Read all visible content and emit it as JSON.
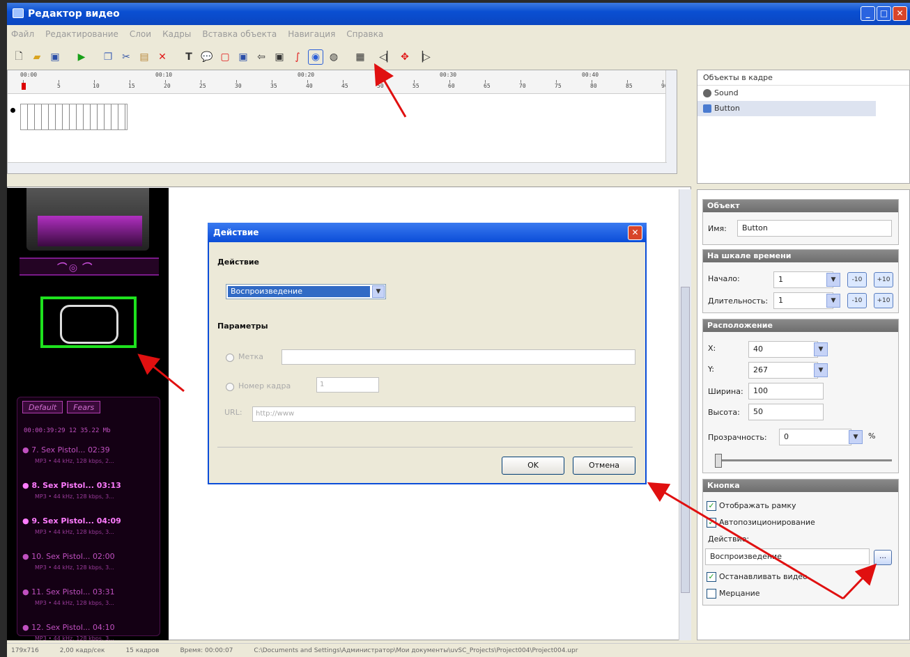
{
  "window": {
    "title": "Редактор видео"
  },
  "menu": [
    "Файл",
    "Редактирование",
    "Слои",
    "Кадры",
    "Вставка объекта",
    "Навигация",
    "Справка"
  ],
  "toolbar_icons": [
    "new-icon",
    "open-icon",
    "save-icon",
    "play-icon",
    "copy-icon",
    "cut-icon",
    "paste-icon",
    "delete-icon",
    "text-icon",
    "callout-icon",
    "rectangle-icon",
    "image-icon",
    "back-icon",
    "frame-icon",
    "pen-icon",
    "button-object-icon",
    "sound-icon",
    "properties-icon",
    "prev-icon",
    "move-icon",
    "next-icon"
  ],
  "timeline": {
    "time_labels": [
      "00:00",
      "00:10",
      "00:20",
      "00:30",
      "00:40"
    ],
    "frame_numbers": [
      "1",
      "5",
      "10",
      "15",
      "20",
      "25",
      "30",
      "35",
      "40",
      "45",
      "50",
      "55",
      "60",
      "65",
      "70",
      "75",
      "80",
      "85",
      "90"
    ]
  },
  "objects_panel": {
    "header": "Объекты в кадре",
    "items": [
      "Sound",
      "Button"
    ]
  },
  "player": {
    "tabs": [
      "Default",
      "Fears"
    ],
    "stat": "00:00:39:29  12     35.22 Mb",
    "tracks": [
      {
        "title": "7. Sex Pistol...",
        "time": "02:39",
        "sub": "MP3 • 44 kHz, 128 kbps, 2..."
      },
      {
        "title": "8. Sex Pistol...",
        "time": "03:13",
        "sub": "MP3 • 44 kHz, 128 kbps, 3..."
      },
      {
        "title": "9. Sex Pistol...",
        "time": "04:09",
        "sub": "MP3 • 44 kHz, 128 kbps, 3..."
      },
      {
        "title": "10. Sex Pistol...",
        "time": "02:00",
        "sub": "MP3 • 44 kHz, 128 kbps, 3..."
      },
      {
        "title": "11. Sex Pistol...",
        "time": "03:31",
        "sub": "MP3 • 44 kHz, 128 kbps, 3..."
      },
      {
        "title": "12. Sex Pistol...",
        "time": "04:10",
        "sub": "MP3 • 44 kHz, 128 kbps, 3..."
      }
    ]
  },
  "dialog": {
    "title": "Действие",
    "action_label": "Действие",
    "action_value": "Воспроизведение",
    "params_label": "Параметры",
    "marker_label": "Метка",
    "frame_label": "Номер кадра",
    "frame_value": "1",
    "url_label": "URL:",
    "url_placeholder": "http://www",
    "ok": "OK",
    "cancel": "Отмена"
  },
  "props": {
    "object": {
      "header": "Объект",
      "name_label": "Имя:",
      "name_value": "Button"
    },
    "timeline": {
      "header": "На шкале времени",
      "start_label": "Начало:",
      "start_value": "1",
      "dur_label": "Длительность:",
      "dur_value": "1",
      "minus": "-10",
      "plus": "+10"
    },
    "position": {
      "header": "Расположение",
      "x_label": "X:",
      "x_value": "40",
      "y_label": "Y:",
      "y_value": "267",
      "w_label": "Ширина:",
      "w_value": "100",
      "h_label": "Высота:",
      "h_value": "50",
      "op_label": "Прозрачность:",
      "op_value": "0",
      "op_unit": "%"
    },
    "button": {
      "header": "Кнопка",
      "show_frame": "Отображать рамку",
      "autopos": "Автопозиционирование",
      "action_label": "Действие:",
      "action_value": "Воспроизведение",
      "stop_video": "Останавливать видео",
      "blink": "Мерцание"
    }
  },
  "status": [
    "179x716",
    "2,00 кадр/сек",
    "15 кадров",
    "Время: 00:00:07",
    "C:\\Documents and Settings\\Администратор\\Мои документы\\uvSC_Projects\\Project004\\Project004.upr"
  ],
  "accent": "#0b4dd8"
}
